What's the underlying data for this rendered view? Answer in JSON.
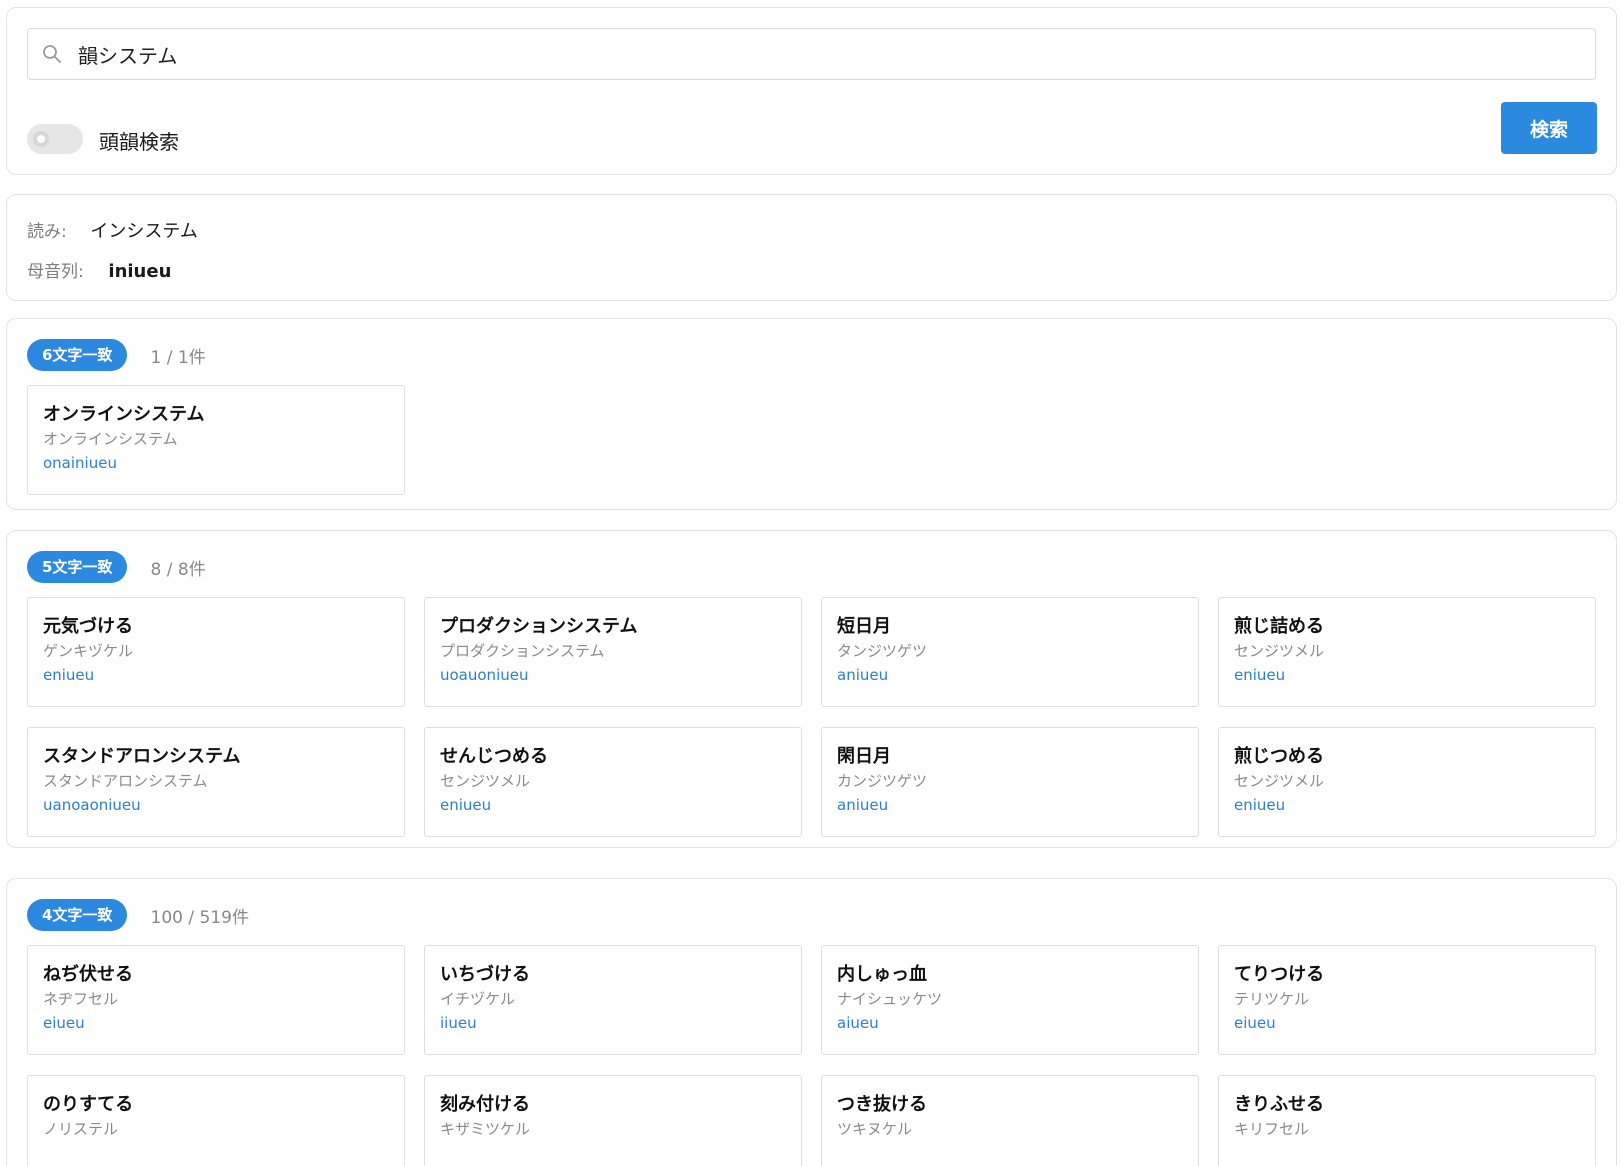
{
  "search": {
    "value": "韻システム",
    "toggle_label": "頭韻検索",
    "button_label": "検索"
  },
  "info": {
    "reading_key": "読み:",
    "reading_value": "インシステム",
    "vowels_key": "母音列:",
    "vowels_value": "iniueu"
  },
  "groups": [
    {
      "badge": "6文字一致",
      "count": "1 / 1件",
      "cards": [
        {
          "word": "オンラインシステム",
          "kana": "オンラインシステム",
          "vowels": "onainiueu"
        }
      ]
    },
    {
      "badge": "5文字一致",
      "count": "8 / 8件",
      "cards": [
        {
          "word": "元気づける",
          "kana": "ゲンキヅケル",
          "vowels": "eniueu"
        },
        {
          "word": "プロダクションシステム",
          "kana": "プロダクションシステム",
          "vowels": "uoauoniueu"
        },
        {
          "word": "短日月",
          "kana": "タンジツゲツ",
          "vowels": "aniueu"
        },
        {
          "word": "煎じ詰める",
          "kana": "センジツメル",
          "vowels": "eniueu"
        },
        {
          "word": "スタンドアロンシステム",
          "kana": "スタンドアロンシステム",
          "vowels": "uanoaoniueu"
        },
        {
          "word": "せんじつめる",
          "kana": "センジツメル",
          "vowels": "eniueu"
        },
        {
          "word": "閑日月",
          "kana": "カンジツゲツ",
          "vowels": "aniueu"
        },
        {
          "word": "煎じつめる",
          "kana": "センジツメル",
          "vowels": "eniueu"
        }
      ]
    },
    {
      "badge": "4文字一致",
      "count": "100 / 519件",
      "cards": [
        {
          "word": "ねぢ伏せる",
          "kana": "ネヂフセル",
          "vowels": "eiueu"
        },
        {
          "word": "いちづける",
          "kana": "イチヅケル",
          "vowels": "iiueu"
        },
        {
          "word": "内しゅっ血",
          "kana": "ナイシュッケツ",
          "vowels": "aiueu"
        },
        {
          "word": "てりつける",
          "kana": "テリツケル",
          "vowels": "eiueu"
        },
        {
          "word": "のりすてる",
          "kana": "ノリステル",
          "vowels": ""
        },
        {
          "word": "刻み付ける",
          "kana": "キザミツケル",
          "vowels": ""
        },
        {
          "word": "つき抜ける",
          "kana": "ツキヌケル",
          "vowels": ""
        },
        {
          "word": "きりふせる",
          "kana": "キリフセル",
          "vowels": ""
        }
      ]
    }
  ]
}
